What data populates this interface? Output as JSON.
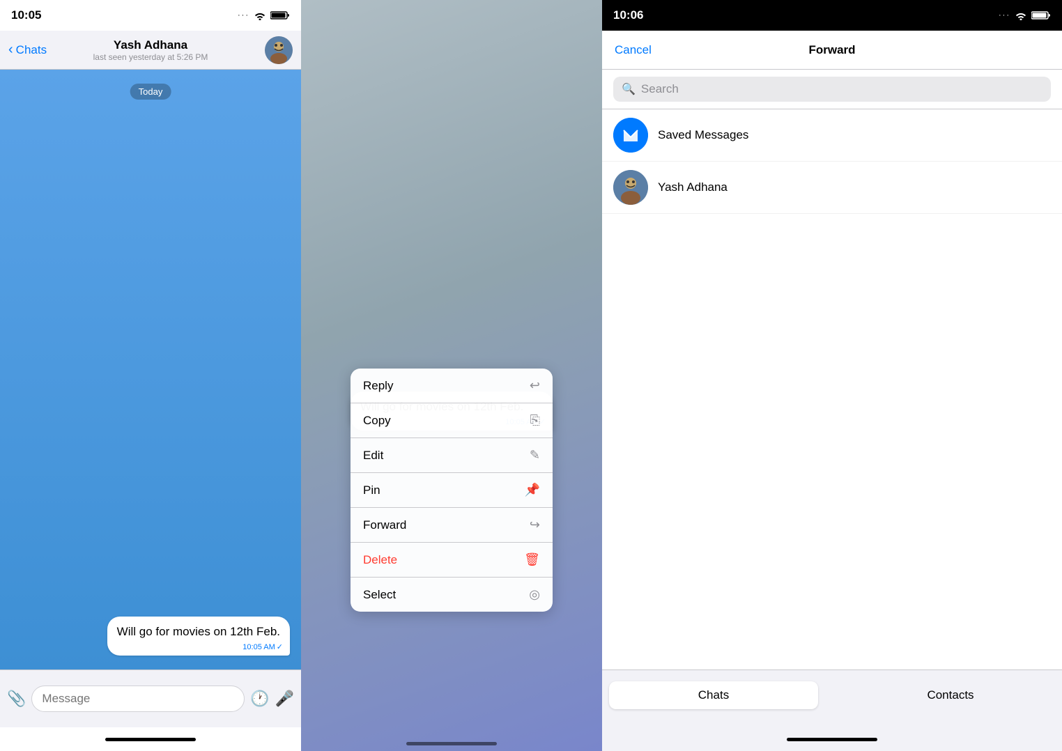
{
  "panel1": {
    "status": {
      "time": "10:05",
      "dots": "···",
      "wifi": "wifi",
      "battery": "battery"
    },
    "nav": {
      "back_label": "Chats",
      "contact_name": "Yash Adhana",
      "last_seen": "last seen yesterday at 5:26 PM"
    },
    "date_badge": "Today",
    "message": {
      "text": "Will go for movies on 12th Feb.",
      "time": "10:05 AM",
      "check": "✓"
    },
    "input": {
      "placeholder": "Message"
    }
  },
  "panel2": {
    "status": {
      "time": ""
    },
    "message": {
      "text": "Will go for movies on 12th Feb.",
      "time": "10:05 AM",
      "check": "✓"
    },
    "menu": [
      {
        "label": "Reply",
        "icon": "↩",
        "delete": false
      },
      {
        "label": "Copy",
        "icon": "⎘",
        "delete": false
      },
      {
        "label": "Edit",
        "icon": "✎",
        "delete": false
      },
      {
        "label": "Pin",
        "icon": "📌",
        "delete": false
      },
      {
        "label": "Forward",
        "icon": "↪",
        "delete": false
      },
      {
        "label": "Delete",
        "icon": "🗑",
        "delete": true
      },
      {
        "label": "Select",
        "icon": "◎",
        "delete": false
      }
    ]
  },
  "panel3": {
    "status": {
      "time": "10:06"
    },
    "nav": {
      "cancel_label": "Cancel",
      "title": "Forward"
    },
    "search": {
      "placeholder": "Search"
    },
    "contacts": [
      {
        "name": "Saved Messages",
        "type": "saved"
      },
      {
        "name": "Yash Adhana",
        "type": "user"
      }
    ],
    "tabs": [
      {
        "label": "Chats",
        "active": true
      },
      {
        "label": "Contacts",
        "active": false
      }
    ]
  }
}
